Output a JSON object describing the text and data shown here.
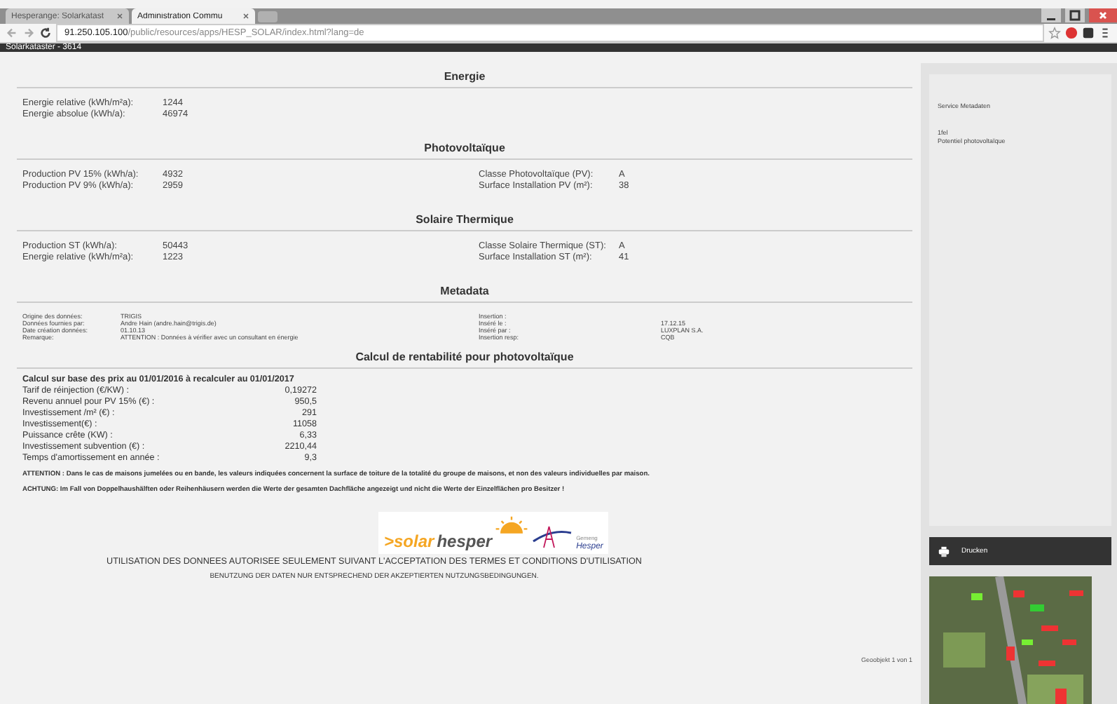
{
  "browser": {
    "tabs": [
      {
        "label": "Hesperange: Solarkatast",
        "selected": false
      },
      {
        "label": "Administration Commu",
        "selected": true
      }
    ],
    "url_host": "91.250.105.100",
    "url_path": "/public/resources/apps/HESP_SOLAR/index.html?lang=de"
  },
  "app_bar": {
    "title": "Solarkataster - 3614"
  },
  "sections": [
    {
      "kind": "pairs",
      "title": "Energie",
      "left": [
        {
          "label": "Energie relative (kWh/m²a):",
          "value": "1244"
        },
        {
          "label": "Energie absolue (kWh/a):",
          "value": "46974"
        }
      ]
    },
    {
      "kind": "pairs",
      "title": "Photovoltaïque",
      "left": [
        {
          "label": "Production PV 15% (kWh/a):",
          "value": "4932"
        },
        {
          "label": "Production PV 9% (kWh/a):",
          "value": "2959"
        }
      ],
      "right": [
        {
          "label": "Classe Photovoltaïque (PV):",
          "value": "A"
        },
        {
          "label": "Surface Installation PV (m²):",
          "value": "38"
        }
      ]
    },
    {
      "kind": "pairs",
      "title": "Solaire Thermique",
      "left": [
        {
          "label": "Production ST (kWh/a):",
          "value": "50443"
        },
        {
          "label": "Energie relative (kWh/m²a):",
          "value": "1223"
        }
      ],
      "right": [
        {
          "label": "Classe Solaire Thermique (ST):",
          "value": "A"
        },
        {
          "label": "Surface Installation ST (m²):",
          "value": "41"
        }
      ]
    },
    {
      "kind": "meta",
      "title": "Metadata",
      "left": [
        {
          "label": "Origine des données:",
          "value": "TRIGIS"
        },
        {
          "label": "Données fournies par:",
          "value": "Andre Hain (andre.hain@trigis.de)"
        },
        {
          "label": "Date création données:",
          "value": "01.10.13"
        },
        {
          "label": "Remarque:",
          "value": "ATTENTION : Données à vérifier avec un consultant en énergie"
        }
      ],
      "right": [
        {
          "label": "Insertion :"
        },
        {
          "label": "Inséré le :",
          "value": "17.12.15"
        },
        {
          "label": "Inséré par :",
          "value": "LUXPLAN S.A."
        },
        {
          "label": "Insertion resp:",
          "value": "CQB"
        }
      ]
    },
    {
      "kind": "calc",
      "title": "Calcul de rentabilité pour photovoltaïque",
      "intro": "Calcul sur base des prix au 01/01/2016 à recalculer au 01/01/2017",
      "left": [
        {
          "label": "Tarif de réinjection (€/KW) :",
          "value": "0,19272"
        },
        {
          "label": "Revenu annuel pour PV 15% (€) :",
          "value": "950,5"
        },
        {
          "label": "Investissement /m² (€) :",
          "value": "291"
        },
        {
          "label": "Investissement(€) :",
          "value": "11058"
        },
        {
          "label": "Puissance crête (KW) :",
          "value": "6,33"
        },
        {
          "label": "Investissement subvention (€) :",
          "value": "2210,44"
        },
        {
          "label": "Temps d'amortissement en année :",
          "value": "9,3"
        }
      ],
      "notes": [
        "ATTENTION : Dans le cas de maisons jumelées ou en bande, les valeurs indiquées concernent la surface de toiture de la totalité du groupe de maisons, et non des valeurs individuelles par maison.",
        "ACHTUNG: Im Fall von Doppelhaushälften oder Reihenhäusern werden die Werte der gesamten Dachfläche angezeigt und nicht die Werte der Einzelflächen pro Besitzer !"
      ]
    }
  ],
  "logo": {
    "prefix": ">solar",
    "name": "hesper",
    "commune_small": "Gemeng",
    "commune": "Hesper"
  },
  "disclaimers": [
    "UTILISATION DES DONNEES AUTORISEE SEULEMENT SUIVANT L'ACCEPTATION DES TERMES ET CONDITIONS D'UTILISATION",
    "BENUTZUNG DER DATEN NUR ENTSPRECHEND DER AKZEPTIERTEN NUTZUNGSBEDINGUNGEN."
  ],
  "pager": "Geoobjekt 1 von 1",
  "sidebar": {
    "service": "Service Metadaten",
    "layer_id": "1fel",
    "layer_name": "Potentiel photovoltaïque",
    "print_button": "Drucken"
  }
}
